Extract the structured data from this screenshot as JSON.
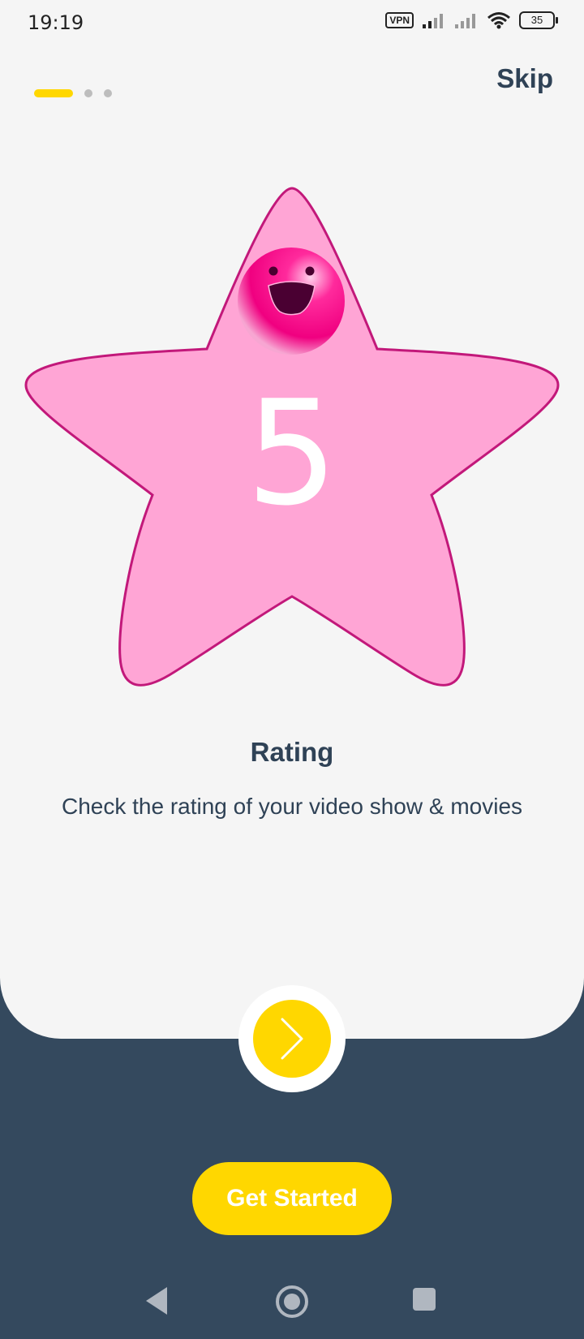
{
  "status_bar": {
    "time": "19:19",
    "vpn": "VPN",
    "battery": "35",
    "icons": [
      "vpn-icon",
      "signal-icon",
      "signal-icon",
      "wifi-icon",
      "battery-icon"
    ]
  },
  "onboarding": {
    "skip_label": "Skip",
    "page_indicator": {
      "current": 1,
      "total": 3
    },
    "illustration": {
      "number": "5"
    },
    "title": "Rating",
    "subtitle": "Check the rating of your video show & movies",
    "next_icon": "chevron-right-icon",
    "get_started_label": "Get Started"
  },
  "nav_bar": {
    "icons": [
      "back-icon",
      "home-icon",
      "recents-icon"
    ]
  },
  "colors": {
    "accent": "#ffd700",
    "dark": "#34495e",
    "text": "#2f4256",
    "panel": "#f5f5f5",
    "star_fill": "#ffa5d5",
    "star_stroke": "#c2187a",
    "ball": "#ff0a8a"
  }
}
